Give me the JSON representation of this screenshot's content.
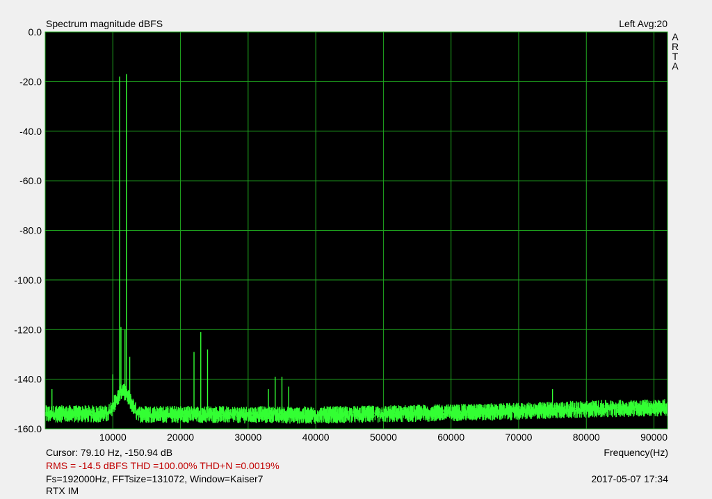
{
  "header": {
    "title": "Spectrum magnitude dBFS",
    "channel_info": "Left  Avg:20",
    "brand_letters": [
      "A",
      "R",
      "T",
      "A"
    ]
  },
  "footer": {
    "cursor": "Cursor: 79.10 Hz, -150.94 dB",
    "x_axis_label": "Frequency(Hz)",
    "stats": "RMS =  -14.5 dBFS   THD =100.00%   THD+N =0.0019%",
    "params": "Fs=192000Hz, FFTsize=131072, Window=Kaiser7",
    "timestamp": "2017-05-07  17:34",
    "note": "RTX IM"
  },
  "colors": {
    "plot_background": "#000000",
    "grid": "#1fa81f",
    "trace": "#33ff33",
    "stats_text": "#c00000"
  },
  "chart_data": {
    "type": "line",
    "title": "Spectrum magnitude dBFS",
    "xlabel": "Frequency(Hz)",
    "ylabel": "",
    "xlim": [
      0,
      92000
    ],
    "ylim": [
      -160,
      0
    ],
    "grid": true,
    "x_ticks": [
      10000,
      20000,
      30000,
      40000,
      50000,
      60000,
      70000,
      80000,
      90000
    ],
    "x_tick_labels": [
      "10000",
      "20000",
      "30000",
      "40000",
      "50000",
      "60000",
      "70000",
      "80000",
      "90000"
    ],
    "y_ticks": [
      0,
      -20,
      -40,
      -60,
      -80,
      -100,
      -120,
      -140,
      -160
    ],
    "y_tick_labels": [
      "0.0",
      "-20.0",
      "-40.0",
      "-60.0",
      "-80.0",
      "-100.0",
      "-120.0",
      "-140.0",
      "-160.0"
    ],
    "noise_floor": [
      [
        0,
        -154
      ],
      [
        10000,
        -154
      ],
      [
        40000,
        -154.5
      ],
      [
        60000,
        -153.5
      ],
      [
        70000,
        -153
      ],
      [
        80000,
        -152
      ],
      [
        92000,
        -151.5
      ]
    ],
    "peaks": [
      {
        "x": 1000,
        "y": -144
      },
      {
        "x": 10000,
        "y": -138
      },
      {
        "x": 11000,
        "y": -18
      },
      {
        "x": 11200,
        "y": -119
      },
      {
        "x": 12000,
        "y": -17
      },
      {
        "x": 11800,
        "y": -120
      },
      {
        "x": 12500,
        "y": -131
      },
      {
        "x": 22000,
        "y": -129
      },
      {
        "x": 23000,
        "y": -121
      },
      {
        "x": 24000,
        "y": -128
      },
      {
        "x": 33000,
        "y": -144
      },
      {
        "x": 34000,
        "y": -139
      },
      {
        "x": 35000,
        "y": -139
      },
      {
        "x": 36000,
        "y": -143
      },
      {
        "x": 75000,
        "y": -144
      }
    ]
  }
}
